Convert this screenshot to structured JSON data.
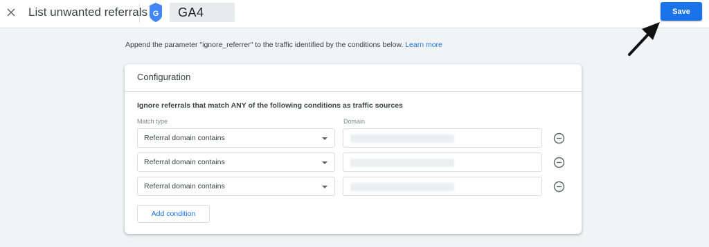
{
  "header": {
    "title": "List unwanted referrals",
    "property_name": "GA4",
    "save_label": "Save",
    "accent_color": "#1a73e8"
  },
  "intro": {
    "text": "Append the parameter \"ignore_referrer\" to the traffic identified by the conditions below.",
    "learn_more": "Learn more"
  },
  "configuration": {
    "title": "Configuration",
    "heading": "Ignore referrals that match ANY of the following conditions as traffic sources",
    "match_type_label": "Match type",
    "domain_label": "Domain",
    "conditions": [
      {
        "match_type": "Referral domain contains"
      },
      {
        "match_type": "Referral domain contains"
      },
      {
        "match_type": "Referral domain contains"
      }
    ],
    "add_condition_label": "Add condition"
  },
  "icons": [
    "close-icon",
    "google-analytics-icon",
    "chevron-down-icon",
    "remove-circle-icon",
    "arrow-pointer-icon"
  ]
}
